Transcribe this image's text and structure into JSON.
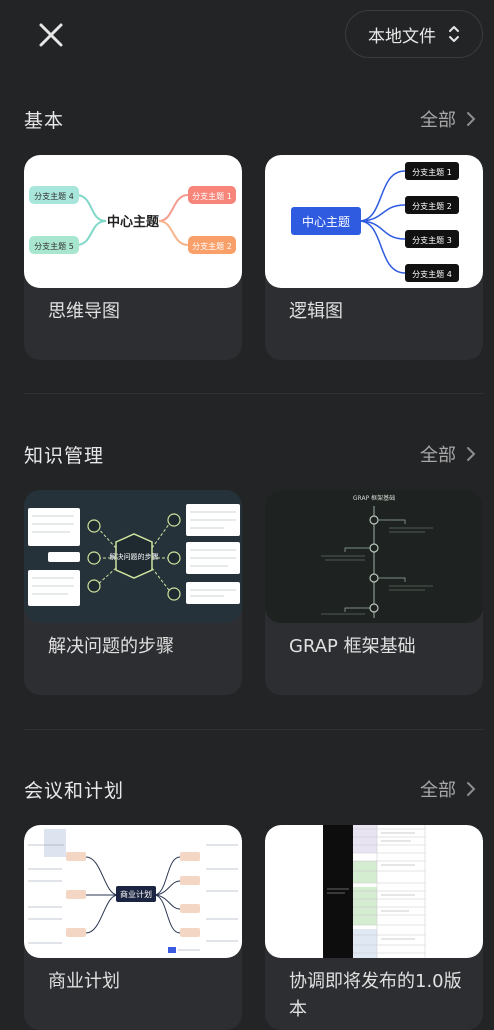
{
  "header": {
    "local_files_label": "本地文件"
  },
  "sections": [
    {
      "title": "基本",
      "all_label": "全部",
      "cards": [
        {
          "label": "思维导图",
          "thumb": {
            "center": "中心主题",
            "b1": "分支主题 1",
            "b2": "分支主题 2",
            "b4": "分支主题 4",
            "b5": "分支主题 5"
          }
        },
        {
          "label": "逻辑图",
          "thumb": {
            "center": "中心主题",
            "b1": "分支主题 1",
            "b2": "分支主题 2",
            "b3": "分支主题 3",
            "b4": "分支主题 4"
          }
        }
      ]
    },
    {
      "title": "知识管理",
      "all_label": "全部",
      "cards": [
        {
          "label": "解决问题的步骤",
          "thumb": {
            "center": "解决问题的步骤"
          }
        },
        {
          "label": "GRAP 框架基础",
          "thumb": {
            "title": "GRAP 框架基础"
          }
        }
      ]
    },
    {
      "title": "会议和计划",
      "all_label": "全部",
      "cards": [
        {
          "label": "商业计划",
          "thumb": {
            "center": "商业计划"
          }
        },
        {
          "label": "协调即将发布的1.0版本",
          "thumb": {}
        }
      ]
    }
  ],
  "colors": {
    "background": "#232426",
    "card": "#2d2e31",
    "text": "#e8e8e8",
    "muted": "#a8a8a8",
    "accent_blue": "#2f5be0"
  }
}
